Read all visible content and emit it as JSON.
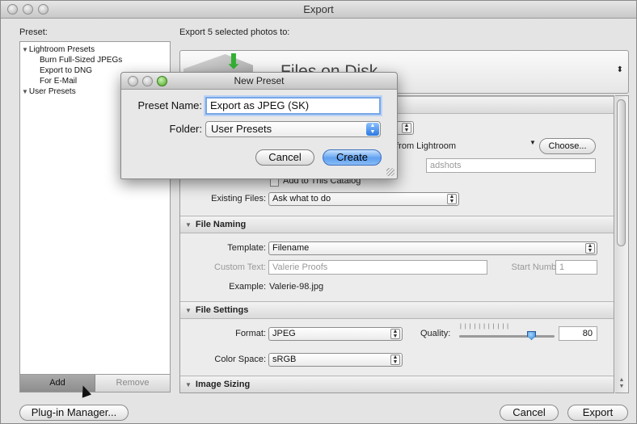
{
  "window": {
    "title": "Export"
  },
  "preset_label": "Preset:",
  "export_to_label": "Export 5 selected photos to:",
  "preset_tree": [
    {
      "type": "folder",
      "label": "Lightroom Presets",
      "expanded": true
    },
    {
      "type": "child",
      "label": "Burn Full-Sized JPEGs"
    },
    {
      "type": "child",
      "label": "Export to DNG"
    },
    {
      "type": "child",
      "label": "For E-Mail"
    },
    {
      "type": "folder",
      "label": "User Presets",
      "expanded": true
    }
  ],
  "list_buttons": {
    "add": "Add",
    "remove": "Remove"
  },
  "destination": {
    "title": "Files on Disk"
  },
  "export_location": {
    "source_text": "Gs from Lightroom",
    "choose_label": "Choose...",
    "folder_value": "adshots",
    "add_to_catalog": "Add to This Catalog",
    "existing_files_label": "Existing Files:",
    "existing_files_value": "Ask what to do"
  },
  "file_naming": {
    "header": "File Naming",
    "template_label": "Template:",
    "template_value": "Filename",
    "custom_text_label": "Custom Text:",
    "custom_text_value": "Valerie Proofs",
    "start_number_label": "Start Number:",
    "start_number_value": "1",
    "example_label": "Example:",
    "example_value": "Valerie-98.jpg"
  },
  "file_settings": {
    "header": "File Settings",
    "format_label": "Format:",
    "format_value": "JPEG",
    "quality_label": "Quality:",
    "quality_value": "80",
    "color_space_label": "Color Space:",
    "color_space_value": "sRGB"
  },
  "image_sizing": {
    "header": "Image Sizing"
  },
  "footer": {
    "plugin_manager": "Plug-in Manager...",
    "cancel": "Cancel",
    "export": "Export"
  },
  "dialog": {
    "title": "New Preset",
    "preset_name_label": "Preset Name:",
    "preset_name_value": "Export as JPEG (SK)",
    "folder_label": "Folder:",
    "folder_value": "User Presets",
    "cancel": "Cancel",
    "create": "Create"
  },
  "colors": {
    "accent": "#5fa0f0",
    "destination_arrow": "#33b033"
  }
}
